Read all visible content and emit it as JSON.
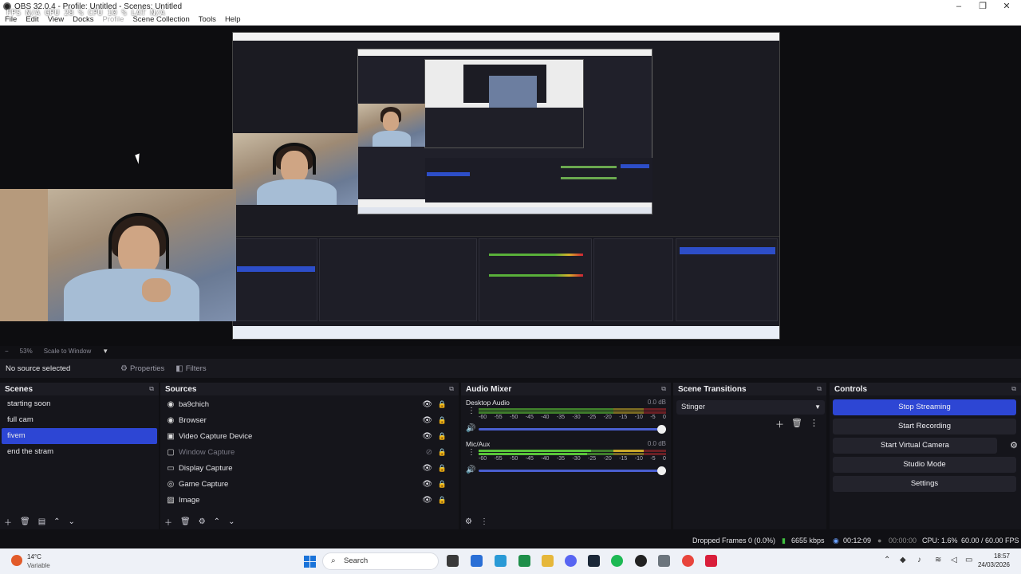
{
  "window": {
    "title": "OBS 32.0.4 - Profile: Untitled - Scenes: Untitled",
    "minimize": "–",
    "maximize": "❐",
    "close": "✕"
  },
  "menu": [
    "File",
    "Edit",
    "View",
    "Docks",
    "Profile",
    "Scene Collection",
    "Tools",
    "Help"
  ],
  "stats_overlay": "FPS  N/A   GPU 28 %   CPU 10 %   LAT  N/A",
  "zoom": {
    "collapse": "−",
    "level": "53%",
    "mode": "Scale to Window",
    "arrow": "▼"
  },
  "source_toolbar": {
    "status": "No source selected",
    "properties": "Properties",
    "filters": "Filters"
  },
  "scenes": {
    "title": "Scenes",
    "items": [
      {
        "label": "starting soon",
        "selected": false
      },
      {
        "label": "full cam",
        "selected": false
      },
      {
        "label": "fivem",
        "selected": true
      },
      {
        "label": "end the stram",
        "selected": false
      }
    ]
  },
  "sources": {
    "title": "Sources",
    "items": [
      {
        "label": "ba9chich",
        "icon": "globe-icon",
        "glyph": "◉",
        "dim": false
      },
      {
        "label": "Browser",
        "icon": "globe-icon",
        "glyph": "◉",
        "dim": false
      },
      {
        "label": "Video Capture Device",
        "icon": "camera-icon",
        "glyph": "▣",
        "dim": false
      },
      {
        "label": "Window Capture",
        "icon": "window-icon",
        "glyph": "▢",
        "dim": true
      },
      {
        "label": "Display Capture",
        "icon": "monitor-icon",
        "glyph": "▭",
        "dim": false
      },
      {
        "label": "Game Capture",
        "icon": "gamepad-icon",
        "glyph": "◎",
        "dim": false
      },
      {
        "label": "Image",
        "icon": "image-icon",
        "glyph": "▨",
        "dim": false
      }
    ]
  },
  "mixer": {
    "title": "Audio Mixer",
    "ticks": [
      "-60",
      "-55",
      "-50",
      "-45",
      "-40",
      "-35",
      "-30",
      "-25",
      "-20",
      "-15",
      "-10",
      "-5",
      "0"
    ],
    "channels": [
      {
        "name": "Desktop Audio",
        "db": "0.0 dB",
        "level": 1.0
      },
      {
        "name": "Mic/Aux",
        "db": "0.0 dB",
        "level": 1.0
      }
    ]
  },
  "transitions": {
    "title": "Scene Transitions",
    "selected": "Stinger"
  },
  "controls": {
    "title": "Controls",
    "stop_streaming": "Stop Streaming",
    "start_recording": "Start Recording",
    "start_virtual_camera": "Start Virtual Camera",
    "studio_mode": "Studio Mode",
    "settings": "Settings"
  },
  "status": {
    "dropped": "Dropped Frames 0 (0.0%)",
    "bitrate": "6655 kbps",
    "stream_time": "00:12:09",
    "rec_time": "00:00:00",
    "cpu": "CPU: 1.6%",
    "fps": "60.00 / 60.00 FPS"
  },
  "taskbar": {
    "temp": "14°C",
    "weather": "Variable",
    "search": "Search",
    "time": "18:57",
    "date": "24/03/2026"
  },
  "colors": {
    "accent": "#2d46d4",
    "panel": "#15151b",
    "background": "#101014"
  }
}
